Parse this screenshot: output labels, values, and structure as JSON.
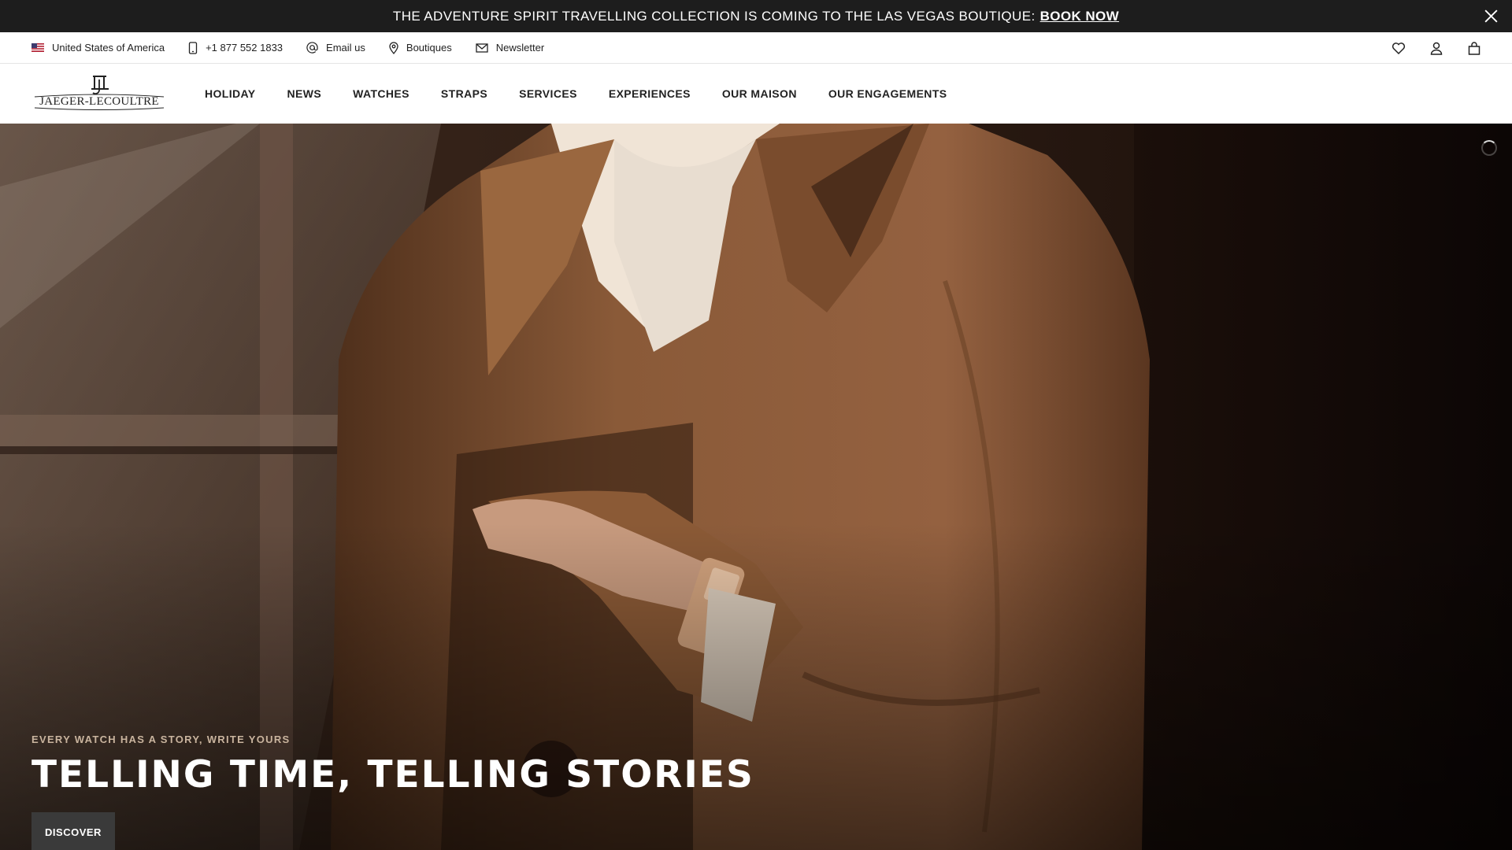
{
  "announcement": {
    "text": "THE ADVENTURE SPIRIT TRAVELLING COLLECTION IS COMING TO THE LAS VEGAS BOUTIQUE:",
    "link": "BOOK NOW",
    "close_icon": "close-icon"
  },
  "utility": {
    "country": "United States of America",
    "phone": "+1 877 552 1833",
    "email": "Email us",
    "boutiques": "Boutiques",
    "newsletter": "Newsletter",
    "icons": [
      "wishlist-heart-icon",
      "account-icon",
      "shopping-bag-icon"
    ]
  },
  "brand": {
    "name": "JAEGER-LECOULTRE"
  },
  "nav": {
    "items": [
      "HOLIDAY",
      "NEWS",
      "WATCHES",
      "STRAPS",
      "SERVICES",
      "EXPERIENCES",
      "OUR MAISON",
      "OUR ENGAGEMENTS"
    ]
  },
  "hero": {
    "eyebrow": "EVERY WATCH HAS A STORY, WRITE YOURS",
    "headline": "TELLING TIME, TELLING STORIES",
    "cta": "DISCOVER"
  },
  "colors": {
    "announcement_bg": "#1d1d1d",
    "coat": "#8a5a38",
    "hero_bg": "#120906",
    "cta_bg": "#3a3a3a"
  }
}
